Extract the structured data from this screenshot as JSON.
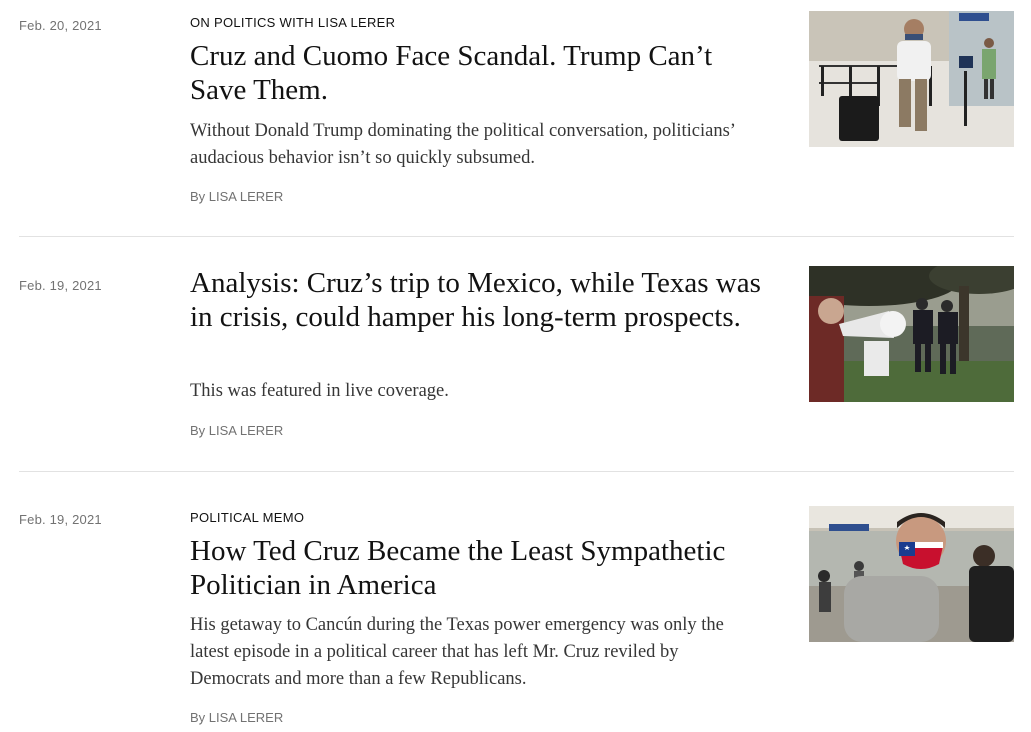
{
  "articles": [
    {
      "date": "Feb. 20, 2021",
      "kicker": "On Politics With Lisa Lerer",
      "headline": "Cruz and Cuomo Face Scandal. Trump Can’t Save Them.",
      "summary": "Without Donald Trump dominating the political conversation, politicians’ audacious behavior isn’t so quickly subsumed.",
      "byline_prefix": "By",
      "author": "Lisa Lerer",
      "image": "airport-traveler-photo"
    },
    {
      "date": "Feb. 19, 2021",
      "kicker": "",
      "headline": "Analysis: Cruz’s trip to Mexico, while Texas was in crisis, could hamper his long-term prospects.",
      "summary": "This was featured in live coverage.",
      "byline_prefix": "By",
      "author": "Lisa Lerer",
      "image": "protest-megaphone-photo"
    },
    {
      "date": "Feb. 19, 2021",
      "kicker": "Political Memo",
      "headline": "How Ted Cruz Became the Least Sympathetic Politician in America",
      "summary": "His getaway to Cancún during the Texas power emergency was only the latest episode in a political career that has left Mr. Cruz reviled by Democrats and more than a few Republicans.",
      "byline_prefix": "By",
      "author": "Lisa Lerer",
      "image": "masked-man-airport-photo"
    }
  ],
  "colors": {
    "text": "#121212",
    "meta": "#727272",
    "summary": "#363636",
    "divider": "#e2e2e2"
  }
}
